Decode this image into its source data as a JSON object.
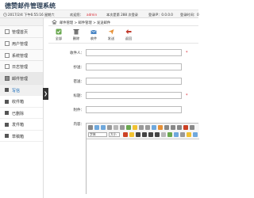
{
  "app": {
    "title": "德赞邮件管理系统"
  },
  "status": {
    "datetime": "2017/2/4 下午6:55:16 星期六",
    "welcome_prefix": "欢迎您：",
    "username": "admin",
    "count_label": "本次是第 288 次登录",
    "ip_label": "登录IP：0.0.0.0",
    "last_login": "登录时间：0"
  },
  "sidebar": {
    "items": [
      {
        "label": "管理首页"
      },
      {
        "label": "用户管理"
      },
      {
        "label": "系统管理"
      },
      {
        "label": "日志管理"
      },
      {
        "label": "邮件管理"
      }
    ],
    "sub_items": [
      {
        "label": "写信"
      },
      {
        "label": "收件箱"
      },
      {
        "label": "已删除"
      },
      {
        "label": "发件箱"
      },
      {
        "label": "草稿箱"
      }
    ],
    "collapse_glyph": "❯"
  },
  "breadcrumb": {
    "text": "邮件管理 > 邮件管理 > 发送邮件"
  },
  "toolbar": {
    "buttons": [
      {
        "label": "全部"
      },
      {
        "label": "删除"
      },
      {
        "label": "收件"
      },
      {
        "label": "发送"
      },
      {
        "label": "返回"
      }
    ]
  },
  "form": {
    "recipient_label": "收件人：",
    "cc_label": "抄送：",
    "bcc_label": "密送：",
    "subject_label": "标题：",
    "attachment_label": "附件：",
    "content_label": "内容：",
    "required_mark": "*"
  },
  "editor": {
    "font_select": "字体",
    "size_select": "大小"
  },
  "colors": {
    "accent_red": "#d9232e",
    "link_blue": "#0b63b6"
  }
}
